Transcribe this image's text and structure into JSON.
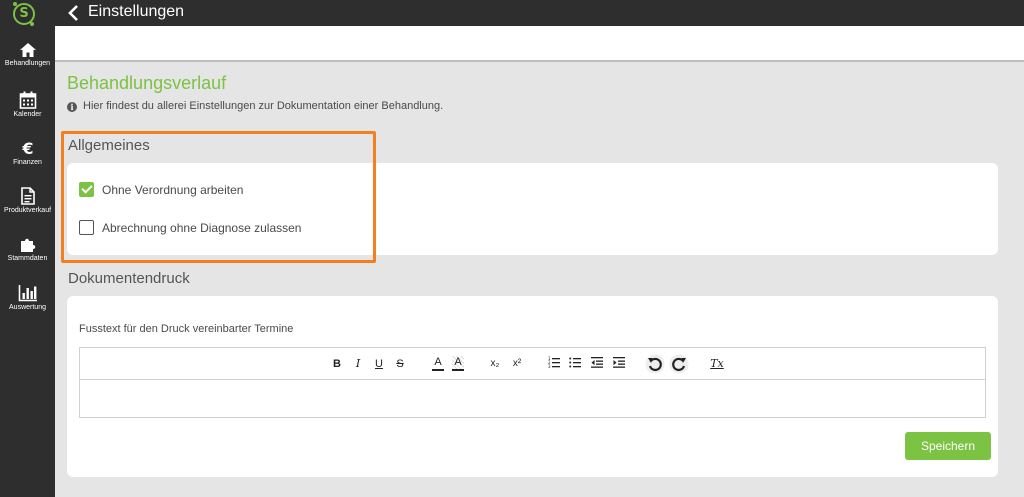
{
  "app": {
    "logo_letter": "S",
    "accent_color": "#7cc243",
    "highlight_color": "#f47f20"
  },
  "sidebar": {
    "items": [
      {
        "label": "Behandlungen",
        "icon": "home-icon"
      },
      {
        "label": "Kalender",
        "icon": "calendar-icon"
      },
      {
        "label": "Finanzen",
        "icon": "euro-icon"
      },
      {
        "label": "Produktverkauf",
        "icon": "document-icon"
      },
      {
        "label": "Stammdaten",
        "icon": "puzzle-icon"
      },
      {
        "label": "Auswertung",
        "icon": "bar-chart-icon"
      }
    ]
  },
  "header": {
    "title": "Einstellungen"
  },
  "main": {
    "page_title": "Behandlungsverlauf",
    "info_text": "Hier findest du allerei Einstellungen zur Dokumentation einer Behandlung.",
    "general": {
      "title": "Allgemeines",
      "options": [
        {
          "label": "Ohne Verordnung arbeiten",
          "checked": true
        },
        {
          "label": "Abrechnung ohne Diagnose zulassen",
          "checked": false
        }
      ]
    },
    "print": {
      "title": "Dokumentendruck",
      "field_label": "Fusstext für den Druck vereinbarter Termine",
      "editor_value": "",
      "toolbar": {
        "bold": "B",
        "italic": "I",
        "underline": "U",
        "strike": "S",
        "font_color": "A",
        "bg_color": "A",
        "subscript": "x₂",
        "superscript": "x²",
        "clear_format": "Tx"
      }
    },
    "save_label": "Speichern"
  }
}
